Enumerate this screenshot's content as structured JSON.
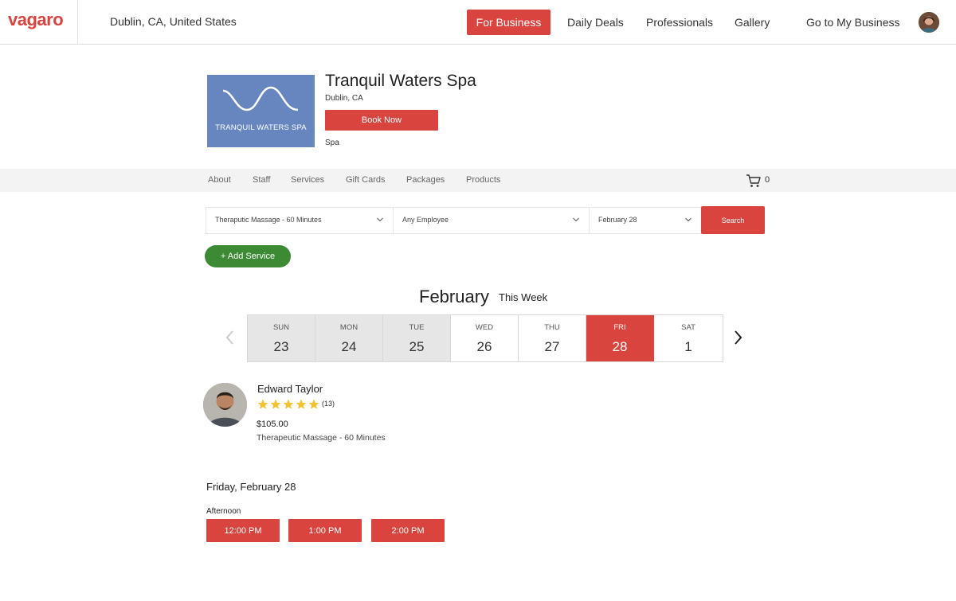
{
  "header": {
    "logo": "vagaro",
    "location": "Dublin, CA, United States",
    "nav": {
      "for_business": "For Business",
      "daily_deals": "Daily Deals",
      "professionals": "Professionals",
      "gallery": "Gallery",
      "go_to_my_business": "Go to My Business"
    }
  },
  "business": {
    "logo_text": "TRANQUIL WATERS SPA",
    "name": "Tranquil Waters Spa",
    "city": "Dublin, CA",
    "book_label": "Book Now",
    "category": "Spa"
  },
  "subnav": {
    "items": [
      "About",
      "Staff",
      "Services",
      "Gift Cards",
      "Packages",
      "Products"
    ],
    "cart_count": "0"
  },
  "search": {
    "service": "Theraputic Massage - 60 Minutes",
    "employee": "Any Employee",
    "date": "February 28",
    "button": "Search"
  },
  "add_service": "+ Add Service",
  "calendar": {
    "month": "February",
    "range_label": "This Week",
    "days": [
      {
        "name": "SUN",
        "num": "23"
      },
      {
        "name": "MON",
        "num": "24"
      },
      {
        "name": "TUE",
        "num": "25"
      },
      {
        "name": "WED",
        "num": "26"
      },
      {
        "name": "THU",
        "num": "27"
      },
      {
        "name": "FRI",
        "num": "28"
      },
      {
        "name": "SAT",
        "num": "1"
      }
    ]
  },
  "provider": {
    "name": "Edward Taylor",
    "rating": 5,
    "reviews": "(13)",
    "price": "$105.00",
    "service": "Therapeutic Massage - 60 Minutes"
  },
  "availability": {
    "date_label": "Friday, February 28",
    "period": "Afternoon",
    "slots": [
      "12:00 PM",
      "1:00 PM",
      "2:00 PM"
    ]
  },
  "colors": {
    "brand_red": "#d9443e",
    "green": "#3c8a34",
    "logo_blue": "#6786c0",
    "star": "#f2c230"
  }
}
